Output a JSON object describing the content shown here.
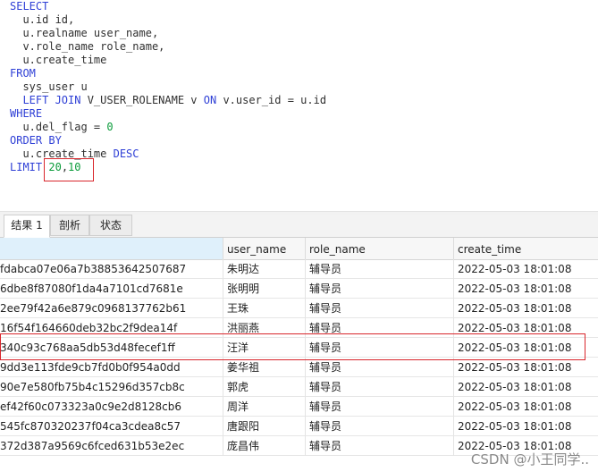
{
  "sql_lines": [
    [
      {
        "t": "SELECT",
        "c": "kw"
      }
    ],
    [
      {
        "t": "  u.id id,",
        "c": "txt"
      }
    ],
    [
      {
        "t": "  u.realname user_name,",
        "c": "txt"
      }
    ],
    [
      {
        "t": "  v.role_name role_name,",
        "c": "txt"
      }
    ],
    [
      {
        "t": "  u.create_time",
        "c": "txt"
      }
    ],
    [
      {
        "t": "FROM",
        "c": "kw"
      }
    ],
    [
      {
        "t": "  sys_user u",
        "c": "txt"
      }
    ],
    [
      {
        "t": "  ",
        "c": "txt"
      },
      {
        "t": "LEFT JOIN",
        "c": "kw"
      },
      {
        "t": " V_USER_ROLENAME v ",
        "c": "txt"
      },
      {
        "t": "ON",
        "c": "kw"
      },
      {
        "t": " v.user_id = u.id",
        "c": "txt"
      }
    ],
    [
      {
        "t": "WHERE",
        "c": "kw"
      }
    ],
    [
      {
        "t": "  u.del_flag = ",
        "c": "txt"
      },
      {
        "t": "0",
        "c": "num"
      }
    ],
    [
      {
        "t": "ORDER BY",
        "c": "kw"
      }
    ],
    [
      {
        "t": "  u.create_time ",
        "c": "txt"
      },
      {
        "t": "DESC",
        "c": "kw"
      }
    ],
    [
      {
        "t": "LIMIT ",
        "c": "kw"
      },
      {
        "t": "20",
        "c": "num"
      },
      {
        "t": ",",
        "c": "txt"
      },
      {
        "t": "10",
        "c": "num"
      }
    ]
  ],
  "tabs": [
    "结果 1",
    "剖析",
    "状态"
  ],
  "columns": [
    "",
    "user_name",
    "role_name",
    "create_time"
  ],
  "rows": [
    [
      "fdabca07e06a7b38853642507687",
      "朱明达",
      "辅导员",
      "2022-05-03 18:01:08"
    ],
    [
      "6dbe8f87080f1da4a7101cd7681e",
      "张明明",
      "辅导员",
      "2022-05-03 18:01:08"
    ],
    [
      "2ee79f42a6e879c0968137762b61",
      "王珠",
      "辅导员",
      "2022-05-03 18:01:08"
    ],
    [
      "16f54f164660deb32bc2f9dea14f",
      "洪丽燕",
      "辅导员",
      "2022-05-03 18:01:08"
    ],
    [
      "340c93c768aa5db53d48fecef1ff",
      "汪洋",
      "辅导员",
      "2022-05-03 18:01:08"
    ],
    [
      "9dd3e113fde9cb7fd0b0f954a0dd",
      "姜华祖",
      "辅导员",
      "2022-05-03 18:01:08"
    ],
    [
      "90e7e580fb75b4c15296d357cb8c",
      "郭虎",
      "辅导员",
      "2022-05-03 18:01:08"
    ],
    [
      "ef42f60c073323a0c9e2d8128cb6",
      "周洋",
      "辅导员",
      "2022-05-03 18:01:08"
    ],
    [
      "545fc870320237f04ca3cdea8c57",
      "唐跟阳",
      "辅导员",
      "2022-05-03 18:01:08"
    ],
    [
      "372d387a9569c6fced631b53e2ec",
      "庞昌伟",
      "辅导员",
      "2022-05-03 18:01:08"
    ]
  ],
  "watermark": "CSDN @小王同学..",
  "colors": {
    "keyword": "#2e3fd6",
    "number": "#0a9b3a",
    "highlight": "#d9262c"
  }
}
